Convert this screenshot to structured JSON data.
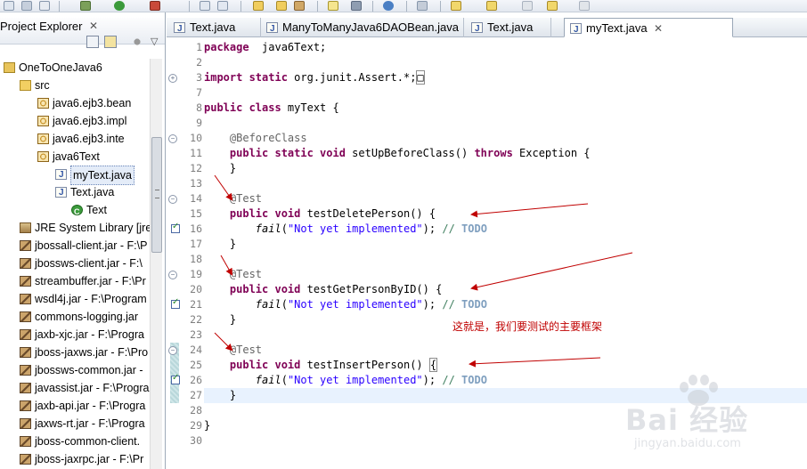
{
  "explorer": {
    "title": "Project Explorer",
    "close_glyph": "✕",
    "tree": [
      {
        "label": "OneToOneJava6",
        "icon": "project-icon",
        "indent": 0
      },
      {
        "label": "src",
        "icon": "source-folder-icon",
        "indent": 1
      },
      {
        "label": "java6.ejb3.bean",
        "icon": "package-icon",
        "indent": 2
      },
      {
        "label": "java6.ejb3.impl",
        "icon": "package-icon",
        "indent": 2
      },
      {
        "label": "java6.ejb3.inte",
        "icon": "package-icon",
        "indent": 2
      },
      {
        "label": "java6Text",
        "icon": "package-icon",
        "indent": 2
      },
      {
        "label": "myText.java",
        "icon": "java-file-icon",
        "indent": 3,
        "selected": true
      },
      {
        "label": "Text.java",
        "icon": "java-file-icon",
        "indent": 3
      },
      {
        "label": "Text",
        "icon": "class-icon",
        "indent": 4
      },
      {
        "label": "JRE System Library [jre",
        "icon": "library-icon",
        "indent": 1
      },
      {
        "label": "jbossall-client.jar - F:\\P",
        "icon": "jar-icon",
        "indent": 1
      },
      {
        "label": "jbossws-client.jar - F:\\",
        "icon": "jar-icon",
        "indent": 1
      },
      {
        "label": "streambuffer.jar - F:\\Pr",
        "icon": "jar-icon",
        "indent": 1
      },
      {
        "label": "wsdl4j.jar - F:\\Program",
        "icon": "jar-icon",
        "indent": 1
      },
      {
        "label": "commons-logging.jar",
        "icon": "jar-icon",
        "indent": 1
      },
      {
        "label": "jaxb-xjc.jar - F:\\Progra",
        "icon": "jar-icon",
        "indent": 1
      },
      {
        "label": "jboss-jaxws.jar - F:\\Pro",
        "icon": "jar-icon",
        "indent": 1
      },
      {
        "label": "jbossws-common.jar -",
        "icon": "jar-icon",
        "indent": 1
      },
      {
        "label": "javassist.jar - F:\\Progra",
        "icon": "jar-icon",
        "indent": 1
      },
      {
        "label": "jaxb-api.jar - F:\\Progra",
        "icon": "jar-icon",
        "indent": 1
      },
      {
        "label": "jaxws-rt.jar - F:\\Progra",
        "icon": "jar-icon",
        "indent": 1
      },
      {
        "label": "jboss-common-client.",
        "icon": "jar-icon",
        "indent": 1
      },
      {
        "label": "jboss-jaxrpc.jar - F:\\Pr",
        "icon": "jar-icon",
        "indent": 1
      }
    ]
  },
  "editor": {
    "tabs": [
      {
        "label": "Text.java",
        "active": false
      },
      {
        "label": "ManyToManyJava6DAOBean.java",
        "active": false
      },
      {
        "label": "Text.java",
        "active": false
      },
      {
        "label": "myText.java",
        "active": true,
        "close_glyph": "✕"
      }
    ],
    "lines": [
      {
        "n": "1",
        "parts": [
          [
            "kw",
            "package"
          ],
          [
            "",
            "  java6Text;"
          ]
        ]
      },
      {
        "n": "2",
        "parts": []
      },
      {
        "n": "3",
        "fold": "+",
        "parts": [
          [
            "kw",
            "import static"
          ],
          [
            "",
            " org.junit.Assert.*;"
          ],
          [
            "box",
            "□"
          ]
        ]
      },
      {
        "n": "7",
        "parts": []
      },
      {
        "n": "8",
        "parts": [
          [
            "kw",
            "public class"
          ],
          [
            "",
            " myText {"
          ]
        ]
      },
      {
        "n": "9",
        "parts": []
      },
      {
        "n": "10",
        "fold": "−",
        "parts": [
          [
            "",
            "    "
          ],
          [
            "ann",
            "@BeforeClass"
          ]
        ]
      },
      {
        "n": "11",
        "parts": [
          [
            "",
            "    "
          ],
          [
            "kw",
            "public static void"
          ],
          [
            "",
            " setUpBeforeClass() "
          ],
          [
            "kw",
            "throws"
          ],
          [
            "",
            " Exception {"
          ]
        ]
      },
      {
        "n": "12",
        "parts": [
          [
            "",
            "    }"
          ]
        ]
      },
      {
        "n": "13",
        "parts": []
      },
      {
        "n": "14",
        "fold": "−",
        "parts": [
          [
            "",
            "    "
          ],
          [
            "ann",
            "@Test"
          ]
        ]
      },
      {
        "n": "15",
        "parts": [
          [
            "",
            "    "
          ],
          [
            "kw",
            "public void"
          ],
          [
            "",
            " testDeletePerson() {"
          ]
        ]
      },
      {
        "n": "16",
        "check": true,
        "parts": [
          [
            "",
            "        "
          ],
          [
            "m",
            "fail"
          ],
          [
            "",
            "("
          ],
          [
            "str",
            "\"Not yet implemented\""
          ],
          [
            "",
            "); "
          ],
          [
            "cmt",
            "// "
          ],
          [
            "todo",
            "TODO"
          ]
        ]
      },
      {
        "n": "17",
        "parts": [
          [
            "",
            "    }"
          ]
        ]
      },
      {
        "n": "18",
        "parts": []
      },
      {
        "n": "19",
        "fold": "−",
        "parts": [
          [
            "",
            "    "
          ],
          [
            "ann",
            "@Test"
          ]
        ]
      },
      {
        "n": "20",
        "parts": [
          [
            "",
            "    "
          ],
          [
            "kw",
            "public void"
          ],
          [
            "",
            " testGetPersonByID() {"
          ]
        ]
      },
      {
        "n": "21",
        "check": true,
        "parts": [
          [
            "",
            "        "
          ],
          [
            "m",
            "fail"
          ],
          [
            "",
            "("
          ],
          [
            "str",
            "\"Not yet implemented\""
          ],
          [
            "",
            "); "
          ],
          [
            "cmt",
            "// "
          ],
          [
            "todo",
            "TODO"
          ]
        ]
      },
      {
        "n": "22",
        "parts": [
          [
            "",
            "    }"
          ]
        ]
      },
      {
        "n": "23",
        "parts": []
      },
      {
        "n": "24",
        "fold": "−",
        "band": true,
        "parts": [
          [
            "",
            "    "
          ],
          [
            "ann",
            "@Test"
          ]
        ]
      },
      {
        "n": "25",
        "band": true,
        "parts": [
          [
            "",
            "    "
          ],
          [
            "kw",
            "public void"
          ],
          [
            "",
            " testInsertPerson() "
          ],
          [
            "box",
            "{"
          ]
        ]
      },
      {
        "n": "26",
        "check": true,
        "band": true,
        "parts": [
          [
            "",
            "        "
          ],
          [
            "m",
            "fail"
          ],
          [
            "",
            "("
          ],
          [
            "str",
            "\"Not yet implemented\""
          ],
          [
            "",
            "); "
          ],
          [
            "cmt",
            "// "
          ],
          [
            "todo",
            "TODO"
          ]
        ]
      },
      {
        "n": "27",
        "current": true,
        "band": true,
        "parts": [
          [
            "",
            "    }"
          ]
        ]
      },
      {
        "n": "28",
        "parts": []
      },
      {
        "n": "29",
        "parts": [
          [
            "",
            "}"
          ]
        ]
      },
      {
        "n": "30",
        "parts": []
      }
    ]
  },
  "annotation": {
    "text": "这就是，我们要测试的主要框架",
    "color": "#c00000"
  },
  "watermark": {
    "brand": "Bai 经验",
    "url": "jingyan.baidu.com"
  }
}
